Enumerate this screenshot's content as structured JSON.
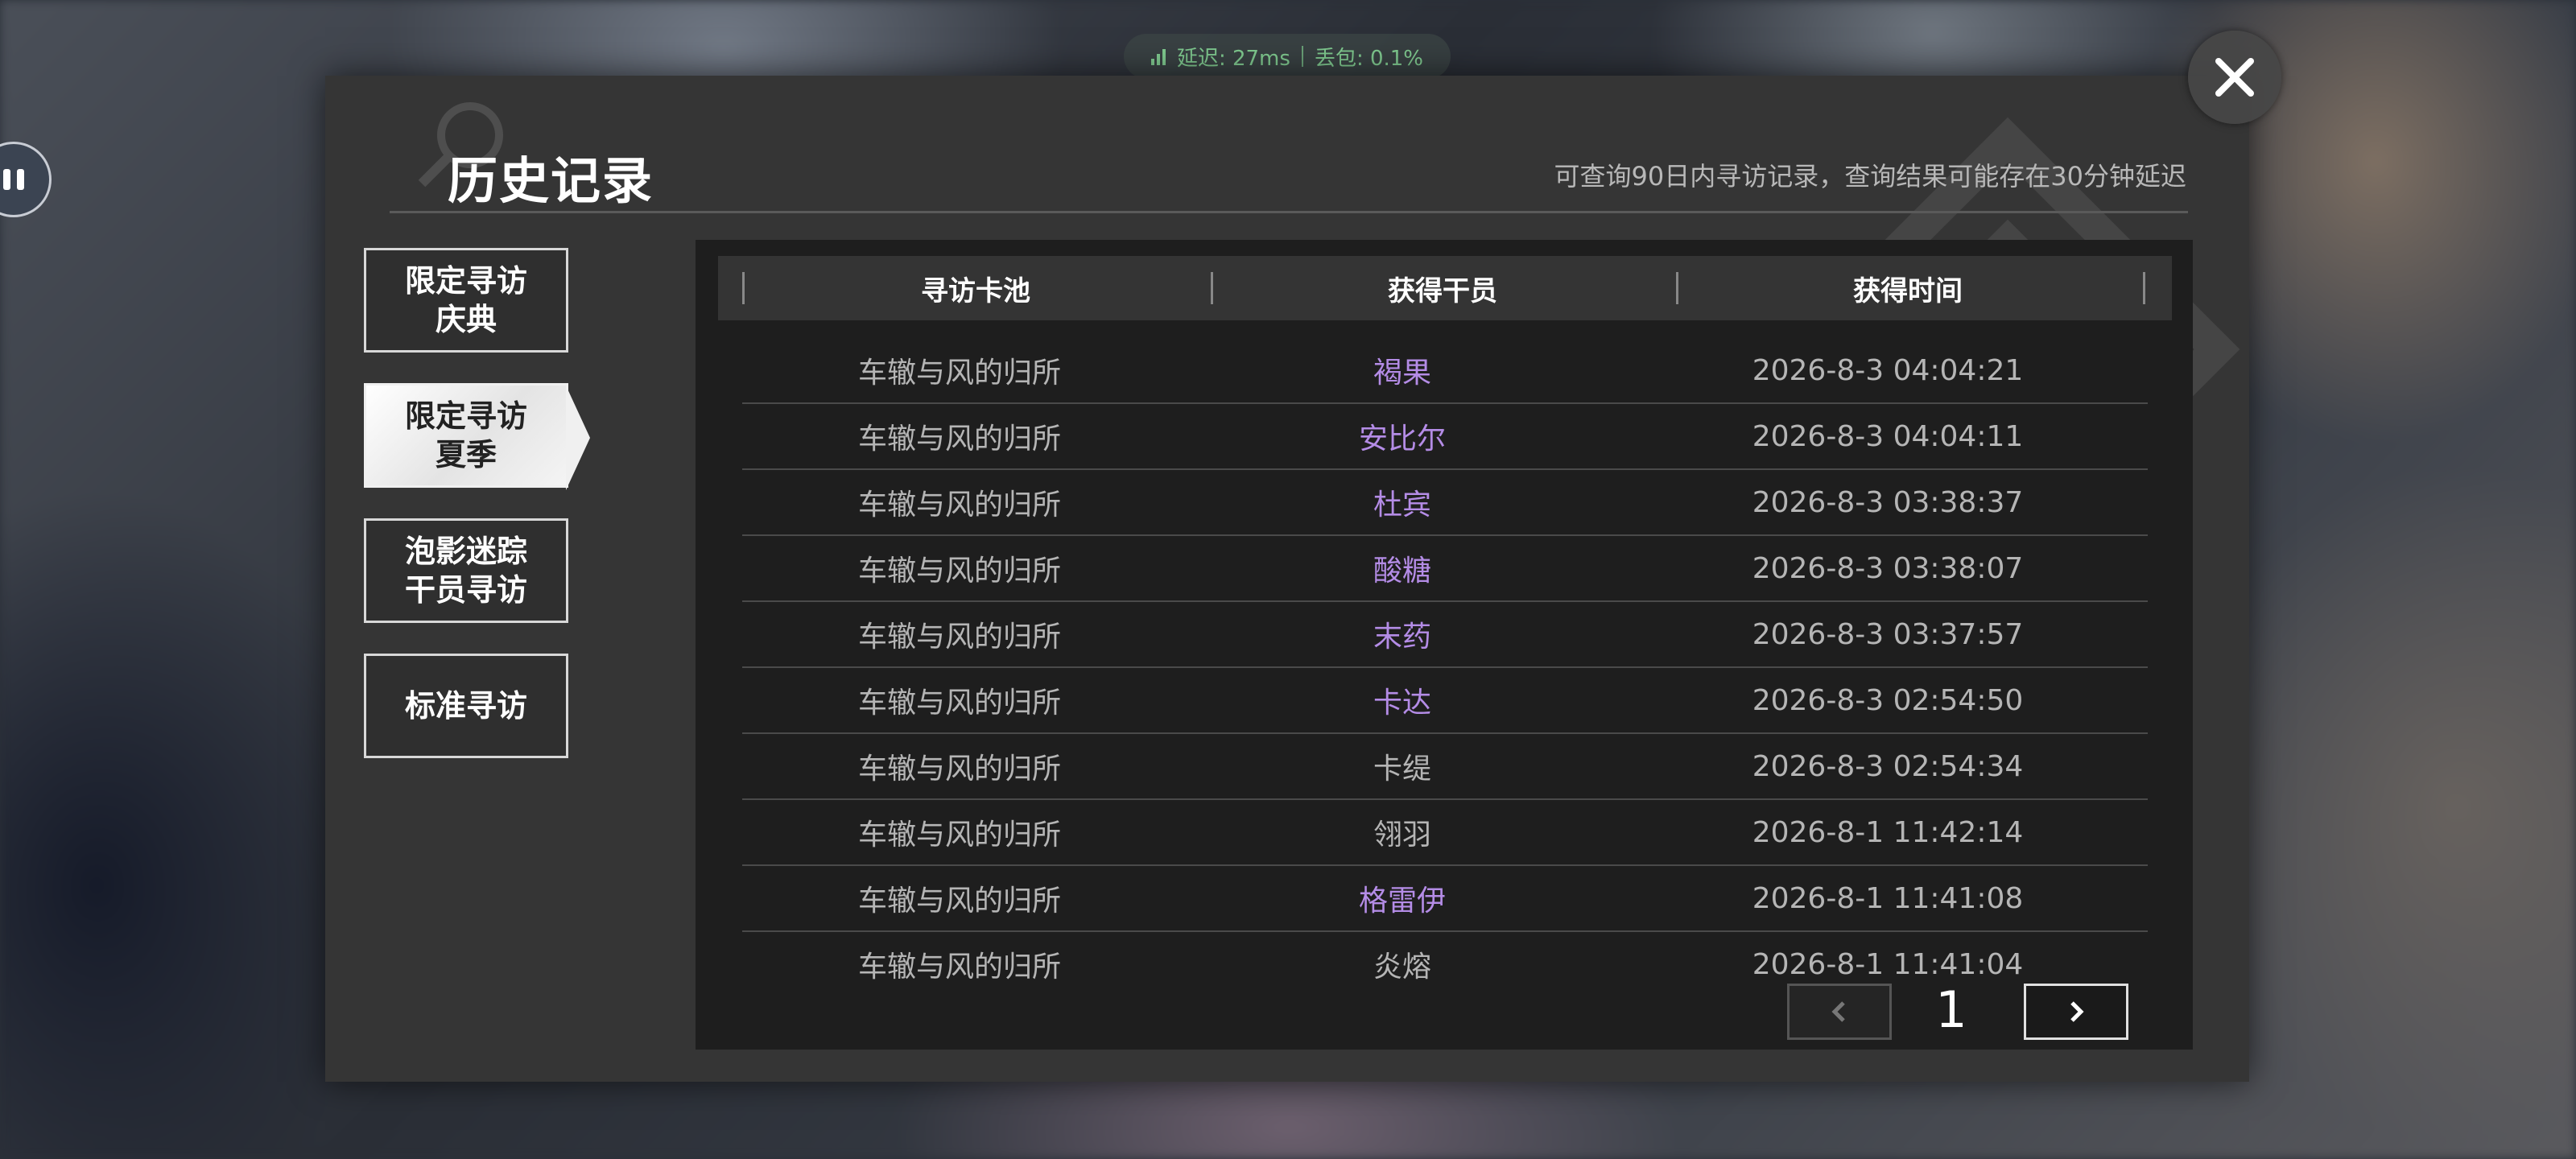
{
  "network": {
    "latency": "延迟: 27ms",
    "loss": "丢包: 0.1%",
    "color": "#7fc98f"
  },
  "panel": {
    "title": "历史记录",
    "subtitle": "可查询90日内寻访记录，查询结果可能存在30分钟延迟"
  },
  "tabs": [
    {
      "line1": "限定寻访",
      "line2": "庆典",
      "active": false
    },
    {
      "line1": "限定寻访",
      "line2": "夏季",
      "active": true
    },
    {
      "line1": "泡影迷踪",
      "line2": "干员寻访",
      "active": false
    },
    {
      "line1": "标准寻访",
      "line2": "",
      "active": false
    }
  ],
  "table": {
    "headers": [
      "寻访卡池",
      "获得干员",
      "获得时间"
    ],
    "rows": [
      {
        "pool": "车辙与风的归所",
        "operator": "褐果",
        "time": "2026-8-3 04:04:21",
        "highlight": true
      },
      {
        "pool": "车辙与风的归所",
        "operator": "安比尔",
        "time": "2026-8-3 04:04:11",
        "highlight": true
      },
      {
        "pool": "车辙与风的归所",
        "operator": "杜宾",
        "time": "2026-8-3 03:38:37",
        "highlight": true
      },
      {
        "pool": "车辙与风的归所",
        "operator": "酸糖",
        "time": "2026-8-3 03:38:07",
        "highlight": true
      },
      {
        "pool": "车辙与风的归所",
        "operator": "末药",
        "time": "2026-8-3 03:37:57",
        "highlight": true
      },
      {
        "pool": "车辙与风的归所",
        "operator": "卡达",
        "time": "2026-8-3 02:54:50",
        "highlight": true
      },
      {
        "pool": "车辙与风的归所",
        "operator": "卡缇",
        "time": "2026-8-3 02:54:34",
        "highlight": false
      },
      {
        "pool": "车辙与风的归所",
        "operator": "翎羽",
        "time": "2026-8-1 11:42:14",
        "highlight": false
      },
      {
        "pool": "车辙与风的归所",
        "operator": "格雷伊",
        "time": "2026-8-1 11:41:08",
        "highlight": true
      },
      {
        "pool": "车辙与风的归所",
        "operator": "炎熔",
        "time": "2026-8-1 11:41:04",
        "highlight": false
      }
    ]
  },
  "pager": {
    "current": "1"
  },
  "colors": {
    "highlight": "#b48ce6",
    "normal": "#b5b5b5"
  },
  "icons": {
    "close": "close-icon",
    "prev": "chevron-left-icon",
    "next": "chevron-right-icon"
  }
}
